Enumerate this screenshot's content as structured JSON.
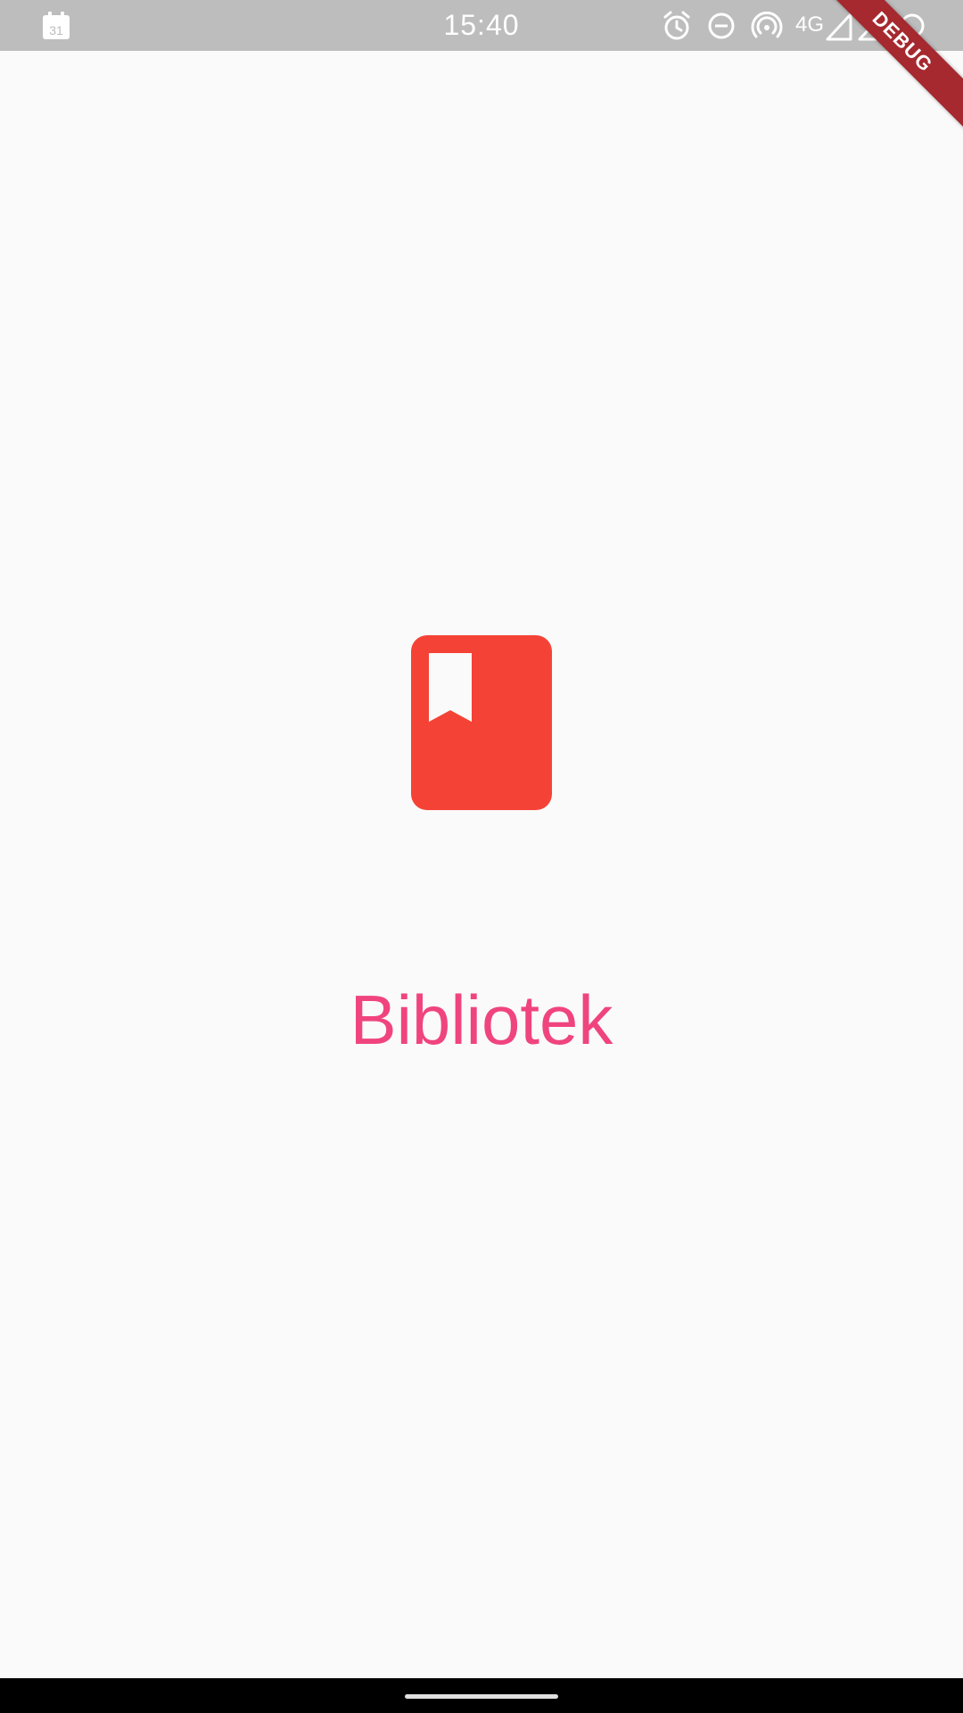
{
  "status_bar": {
    "time": "15:40",
    "network_label": "4G",
    "calendar_day": "31",
    "icons": [
      "calendar-icon",
      "alarm-icon",
      "do-not-disturb-icon",
      "hotspot-icon",
      "signal-icon",
      "signal-icon-2",
      "battery-icon"
    ],
    "background_color": "#BDBDBD"
  },
  "debug_banner": {
    "label": "DEBUG",
    "color": "#A5292F"
  },
  "splash": {
    "logo_icon": "bookmark-book-icon",
    "logo_color": "#F44336",
    "title": "Bibliotek",
    "title_color": "#F0447F"
  },
  "page": {
    "background_color": "#FAFAFA"
  }
}
